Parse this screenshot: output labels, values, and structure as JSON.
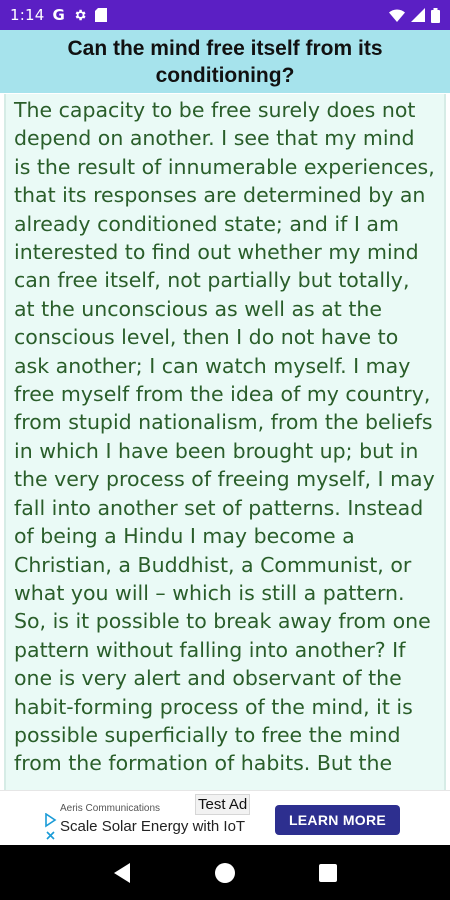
{
  "status_bar": {
    "time": "1:14",
    "left_icons": [
      "google-g-icon",
      "settings-gear-icon",
      "sd-card-icon"
    ],
    "right_icons": [
      "wifi-icon",
      "cell-signal-icon",
      "battery-icon"
    ],
    "g_letter": "G"
  },
  "header": {
    "title": "Can the mind free itself from its conditioning?"
  },
  "article": {
    "text": "The capacity to be free surely does not depend on another. I see that my mind is the result of innumerable experiences, that its responses are determined by an already conditioned state; and if I am interested to find out whether my mind can free itself, not partially but totally, at the unconscious as well as at the conscious level, then I do not have to ask another; I can watch myself. I may free myself from the idea of my country, from stupid nationalism, from the beliefs in which I have been brought up; but in the very process of freeing myself, I may fall into another set of patterns. Instead of being a Hindu I may become a Christian, a Buddhist, a Communist, or what you will – which is still a pattern. So, is it possible to break away from one pattern without falling into another? If one is very alert and observant of the habit-forming process of the mind, it is possible superficially to free the mind from the formation of habits. But the"
  },
  "ad": {
    "advertiser": "Aeris Communications",
    "badge": "Test Ad",
    "headline": "Scale Solar Energy with IoT",
    "cta": "LEARN MORE"
  },
  "colors": {
    "status_bar": "#5b1fc4",
    "title_bar": "#a6e3ec",
    "content_bg": "#eafaf6",
    "text": "#2a5e2a",
    "ad_button": "#2d2f8f"
  },
  "nav_bar": {
    "buttons": [
      "back-icon",
      "home-icon",
      "recents-icon"
    ]
  }
}
